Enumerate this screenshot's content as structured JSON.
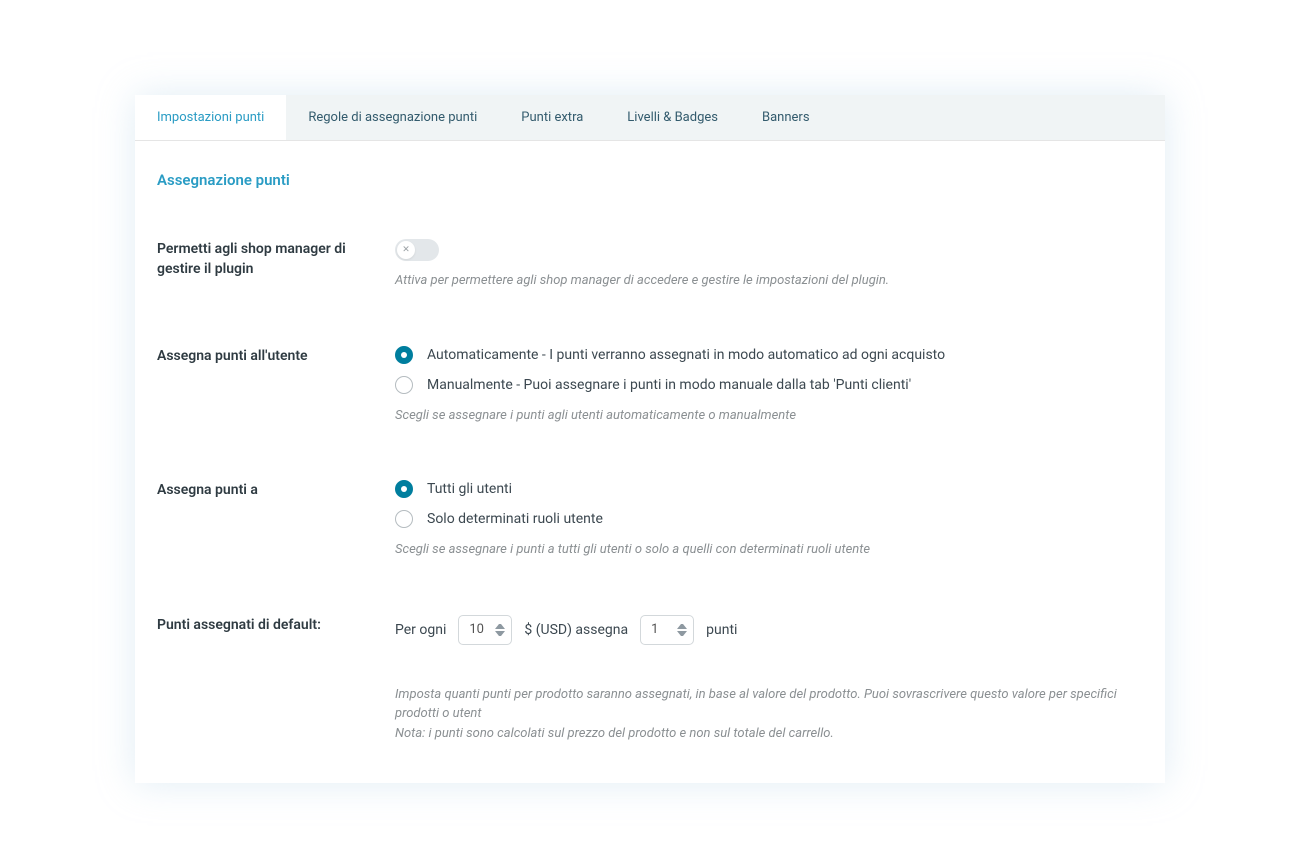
{
  "tabs": [
    {
      "label": "Impostazioni punti",
      "active": true
    },
    {
      "label": "Regole di assegnazione punti",
      "active": false
    },
    {
      "label": "Punti extra",
      "active": false
    },
    {
      "label": "Livelli & Badges",
      "active": false
    },
    {
      "label": "Banners",
      "active": false
    }
  ],
  "section_title": "Assegnazione punti",
  "fields": {
    "shop_manager": {
      "label": "Permetti agli shop manager di gestire il plugin",
      "enabled": false,
      "help": "Attiva per permettere agli shop manager di accedere e gestire le impostazioni del plugin."
    },
    "assign_user": {
      "label": "Assegna punti all'utente",
      "options": [
        {
          "label": "Automaticamente - I punti verranno assegnati in modo automatico ad ogni acquisto",
          "checked": true
        },
        {
          "label": "Manualmente - Puoi assegnare i punti in modo manuale dalla tab 'Punti clienti'",
          "checked": false
        }
      ],
      "help": "Scegli se assegnare i punti agli utenti automaticamente o manualmente"
    },
    "assign_to": {
      "label": "Assegna punti a",
      "options": [
        {
          "label": "Tutti gli utenti",
          "checked": true
        },
        {
          "label": "Solo determinati ruoli utente",
          "checked": false
        }
      ],
      "help": "Scegli se assegnare i punti a tutti gli utenti o solo a quelli con determinati ruoli utente"
    },
    "default_points": {
      "label": "Punti assegnati di default:",
      "prefix": "Per ogni",
      "amount": "10",
      "middle": "$ (USD) assegna",
      "points": "1",
      "suffix": "punti",
      "help1": "Imposta quanti punti per prodotto saranno assegnati, in base al valore del prodotto. Puoi sovrascrivere questo valore per specifici prodotti o utent",
      "help2": "Nota: i punti sono calcolati sul prezzo del prodotto e non sul totale del carrello."
    }
  }
}
